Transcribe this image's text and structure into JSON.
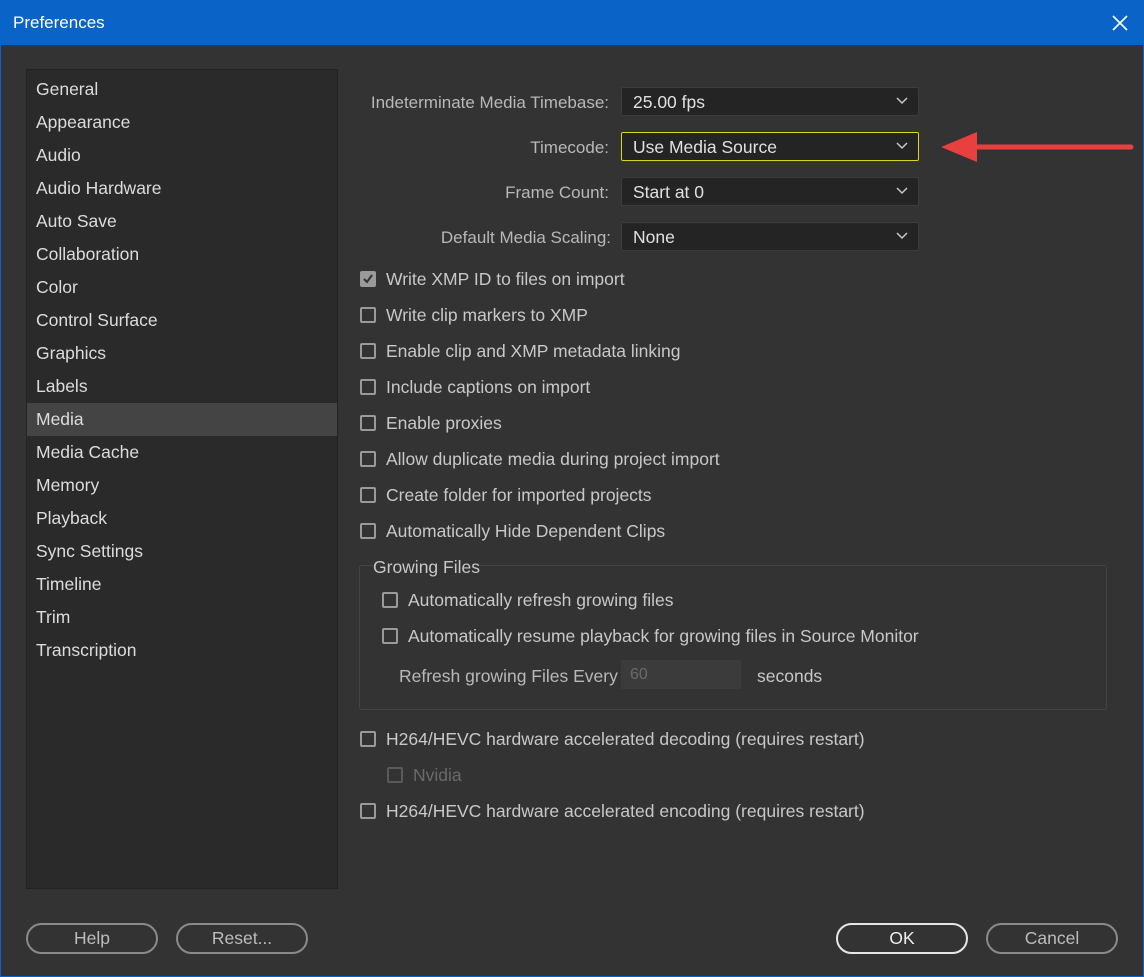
{
  "window": {
    "title": "Preferences",
    "title_color": "#0a64c8"
  },
  "sidebar": {
    "items": [
      {
        "label": "General"
      },
      {
        "label": "Appearance"
      },
      {
        "label": "Audio"
      },
      {
        "label": "Audio Hardware"
      },
      {
        "label": "Auto Save"
      },
      {
        "label": "Collaboration"
      },
      {
        "label": "Color"
      },
      {
        "label": "Control Surface"
      },
      {
        "label": "Graphics"
      },
      {
        "label": "Labels"
      },
      {
        "label": "Media"
      },
      {
        "label": "Media Cache"
      },
      {
        "label": "Memory"
      },
      {
        "label": "Playback"
      },
      {
        "label": "Sync Settings"
      },
      {
        "label": "Timeline"
      },
      {
        "label": "Trim"
      },
      {
        "label": "Transcription"
      }
    ],
    "selected": "Media"
  },
  "media": {
    "timebase": {
      "label": "Indeterminate Media Timebase:",
      "value": "25.00 fps"
    },
    "timecode": {
      "label": "Timecode:",
      "value": "Use Media Source"
    },
    "frame_count": {
      "label": "Frame Count:",
      "value": "Start at 0"
    },
    "scaling": {
      "label": "Default Media Scaling:",
      "value": "None"
    },
    "checks": [
      {
        "label": "Write XMP ID to files on import",
        "checked": true
      },
      {
        "label": "Write clip markers to XMP",
        "checked": false
      },
      {
        "label": "Enable clip and XMP metadata linking",
        "checked": false
      },
      {
        "label": "Include captions on import",
        "checked": false
      },
      {
        "label": "Enable proxies",
        "checked": false
      },
      {
        "label": "Allow duplicate media during project import",
        "checked": false
      },
      {
        "label": "Create folder for imported projects",
        "checked": false
      },
      {
        "label": "Automatically Hide Dependent Clips",
        "checked": false
      }
    ],
    "growing": {
      "title": "Growing Files",
      "auto_refresh": "Automatically refresh growing files",
      "auto_resume": "Automatically resume playback for growing files in Source Monitor",
      "refresh_label": "Refresh growing Files Every",
      "refresh_value": "60",
      "seconds": "seconds"
    },
    "hw_decoding": "H264/HEVC hardware accelerated decoding (requires restart)",
    "nvidia": "Nvidia",
    "hw_encoding": "H264/HEVC hardware accelerated encoding (requires restart)"
  },
  "buttons": {
    "help": "Help",
    "reset": "Reset...",
    "ok": "OK",
    "cancel": "Cancel"
  },
  "annotation": {
    "arrow_color": "#e84040"
  }
}
